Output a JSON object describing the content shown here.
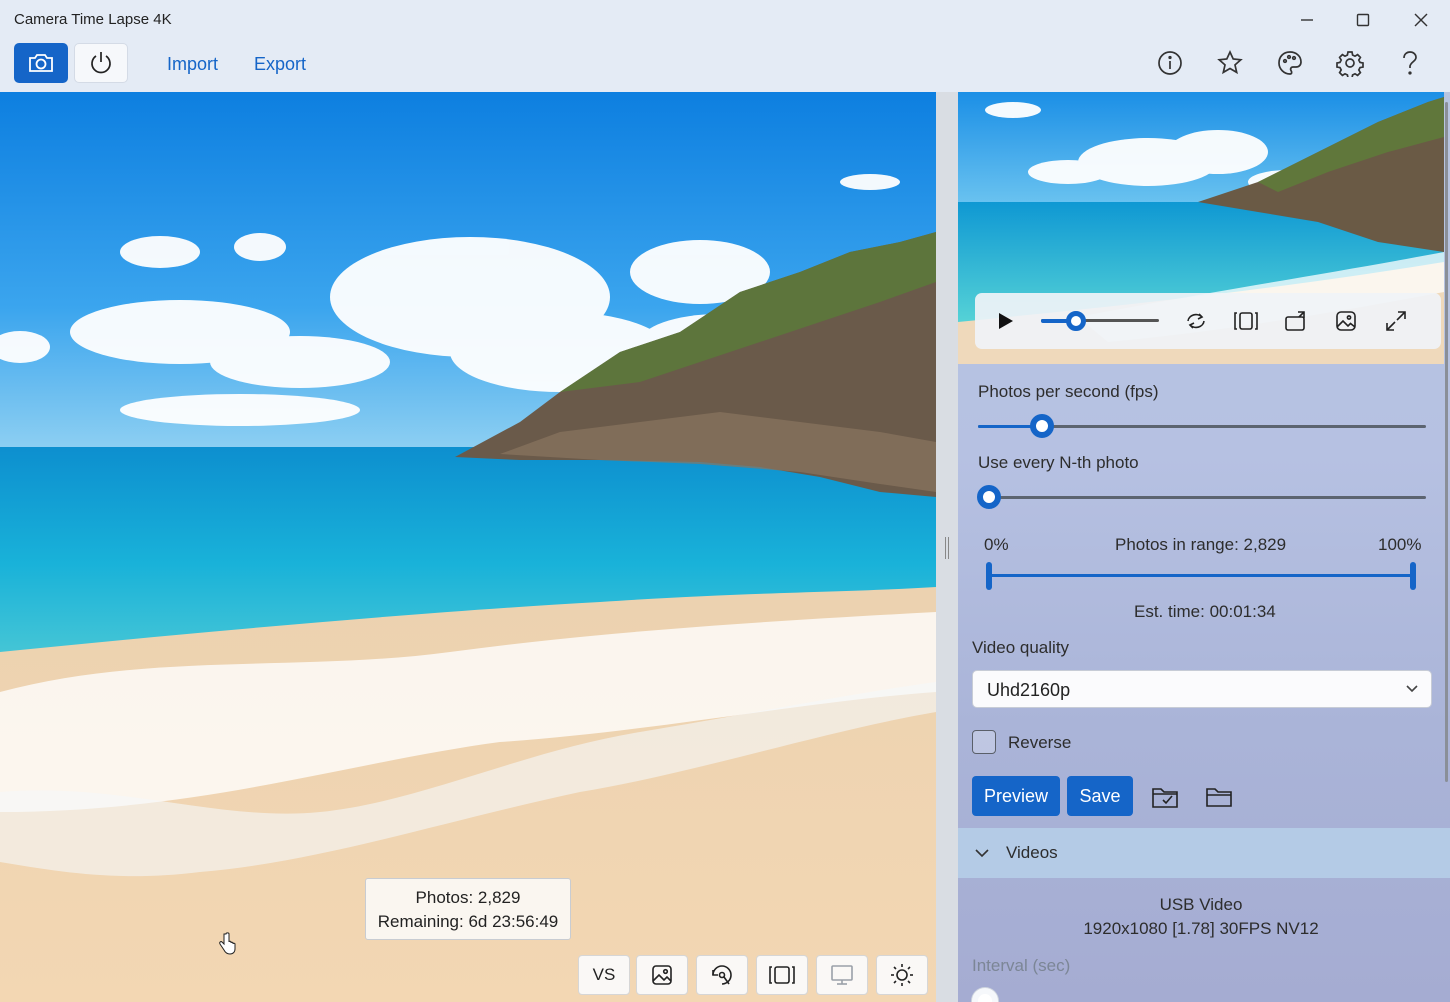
{
  "window": {
    "title": "Camera Time Lapse 4K"
  },
  "toolbar": {
    "import_label": "Import",
    "export_label": "Export"
  },
  "capture_overlay": {
    "photos": "Photos: 2,829",
    "remaining": "Remaining: 6d 23:56:49"
  },
  "bottom_toolbar": {
    "vs_label": "VS"
  },
  "settings": {
    "fps_label": "Photos per second (fps)",
    "fps_level": 0.14,
    "nth_label": "Use every N-th photo",
    "nth_level": 0.0,
    "range_start": "0%",
    "range_end": "100%",
    "photos_in_range": "Photos in range: 2,829",
    "est_time": "Est. time: 00:01:34",
    "quality_label": "Video quality",
    "quality_value": "Uhd2160p",
    "reverse_label": "Reverse",
    "reverse_checked": false,
    "preview_button": "Preview",
    "save_button": "Save"
  },
  "videos": {
    "header": "Videos",
    "device_name": "USB Video",
    "device_format": "1920x1080 [1.78] 30FPS NV12",
    "interval_label": "Interval (sec)"
  },
  "icons": {
    "toolbar": [
      "camera-icon",
      "power-icon",
      "info-icon",
      "star-icon",
      "palette-icon",
      "settings-gear-icon",
      "help-icon"
    ],
    "player": [
      "play-icon",
      "loop-icon",
      "frame-icon",
      "rotate-icon",
      "image-icon",
      "fullscreen-icon"
    ],
    "bottom": [
      "image-icon",
      "rotate-focus-icon",
      "frame-icon",
      "monitor-icon",
      "brightness-icon"
    ]
  },
  "colors": {
    "accent": "#1565c8",
    "titlebar": "#e4ebf5"
  }
}
